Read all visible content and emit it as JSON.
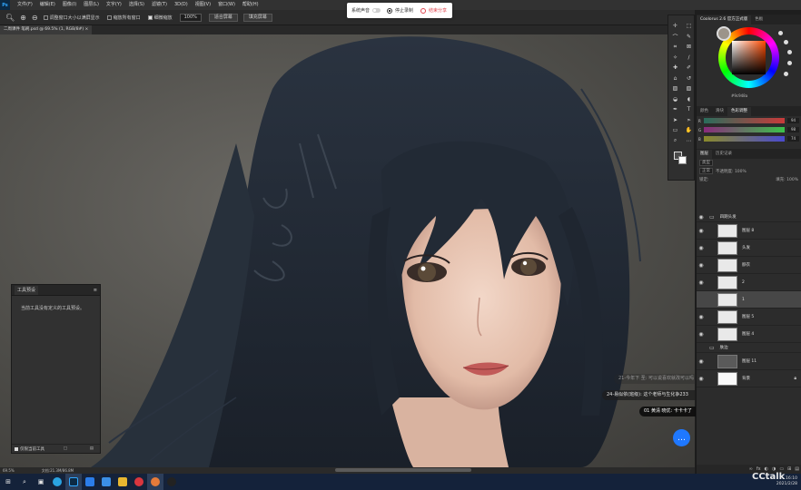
{
  "app": {
    "logo": "Ps",
    "menus": [
      "文件(F)",
      "编辑(E)",
      "图像(I)",
      "图层(L)",
      "文字(Y)",
      "选择(S)",
      "滤镜(T)",
      "3D(D)",
      "视图(V)",
      "窗口(W)",
      "帮助(H)"
    ]
  },
  "options": {
    "resize_windows": "调整窗口大小以满屏显示",
    "zoom_all": "缩放所有窗口",
    "scrubby_zoom": "细微缩放",
    "zoom_value": "100%",
    "fit_screen": "适合屏幕",
    "fill_screen": "填充屏幕"
  },
  "recording": {
    "system_sound": "系统声音",
    "stop": "停止录制",
    "end_share": "结束分享"
  },
  "document": {
    "tab_label": "二周课件  笔刷.psd @ 69.5% (1, RGB/8#)"
  },
  "tool_preset": {
    "title": "工具预设",
    "empty_message": "当前工具没有定义的工具预设。",
    "current_only": "仅限当前工具"
  },
  "chat": {
    "messages": [
      "21-今年下 圣: 可以说喜欢就改可以吗",
      "24-易似依(班级): 这个老师与生化争233",
      "01 黄清 晓优: 卡卡卡了"
    ]
  },
  "status": {
    "zoom": "69.5%",
    "doc_info": "文档:21.3M/86.8M"
  },
  "color_panel": {
    "tabs": [
      "Coolorus 2.6 官方正式版",
      "色板"
    ],
    "hex": "#9c948a",
    "slider_tabs": [
      "颜色",
      "滑块",
      "色彩调整"
    ],
    "slider_values": [
      "94",
      "98",
      "74"
    ],
    "slider_labels": [
      "R",
      "G",
      "B"
    ]
  },
  "layers_panel": {
    "tabs": [
      "图层",
      "历史记录"
    ],
    "kind": "类型",
    "blend_mode": "正常",
    "opacity_label": "不透明度: 100%",
    "lock_label": "锁定:",
    "fill_label": "填充: 100%",
    "layers": [
      {
        "name": "四期头发",
        "type": "group"
      },
      {
        "name": "图层 8",
        "type": "layer"
      },
      {
        "name": "头发",
        "type": "layer"
      },
      {
        "name": "脖衣",
        "type": "layer"
      },
      {
        "name": "2",
        "type": "layer"
      },
      {
        "name": "1",
        "type": "layer",
        "selected": true
      },
      {
        "name": "图层 5",
        "type": "layer"
      },
      {
        "name": "图层 4",
        "type": "layer"
      },
      {
        "name": "肤边",
        "type": "group"
      },
      {
        "name": "图层 11",
        "type": "layer"
      },
      {
        "name": "背景",
        "type": "layer",
        "locked": true
      }
    ]
  },
  "taskbar": {
    "watermark": "CCtalk",
    "time": "16:10",
    "date": "2021/2/28"
  }
}
